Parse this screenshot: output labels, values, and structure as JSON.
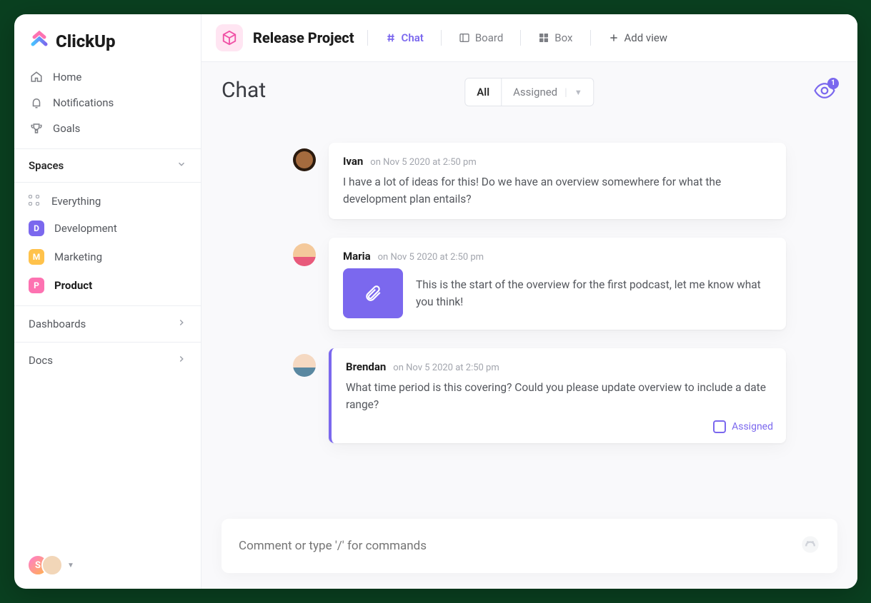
{
  "brand": {
    "name": "ClickUp"
  },
  "sidebar": {
    "nav": [
      {
        "label": "Home"
      },
      {
        "label": "Notifications"
      },
      {
        "label": "Goals"
      }
    ],
    "spaces_header": "Spaces",
    "everything_label": "Everything",
    "spaces": [
      {
        "initial": "D",
        "label": "Development",
        "badgeClass": "dev"
      },
      {
        "initial": "M",
        "label": "Marketing",
        "badgeClass": "mkt"
      },
      {
        "initial": "P",
        "label": "Product",
        "badgeClass": "prd"
      }
    ],
    "dashboards_label": "Dashboards",
    "docs_label": "Docs",
    "avatar_initial": "S"
  },
  "topbar": {
    "project_title": "Release Project",
    "views": [
      {
        "label": "Chat",
        "active": true
      },
      {
        "label": "Board"
      },
      {
        "label": "Box"
      }
    ],
    "add_view_label": "Add view"
  },
  "content": {
    "title": "Chat",
    "filters": {
      "all": "All",
      "assigned": "Assigned"
    },
    "watch_count": "1"
  },
  "messages": [
    {
      "author": "Ivan",
      "timestamp": "on Nov 5 2020 at 2:50 pm",
      "body": "I have a lot of ideas for this! Do we have an overview somewhere for what the development plan entails?"
    },
    {
      "author": "Maria",
      "timestamp": "on Nov 5 2020 at 2:50 pm",
      "body": "This is the start of the overview for the first podcast, let me know what you think!",
      "attachment": true
    },
    {
      "author": "Brendan",
      "timestamp": "on Nov 5 2020 at 2:50 pm",
      "body": "What time period is this covering? Could you please update overview to include a date range?",
      "assigned_label": "Assigned"
    }
  ],
  "composer": {
    "placeholder": "Comment or type '/' for commands"
  }
}
